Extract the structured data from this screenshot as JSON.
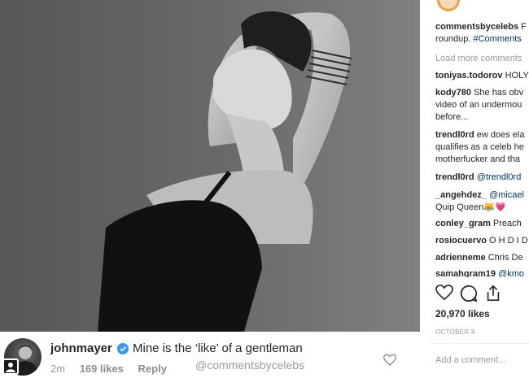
{
  "comments": [
    {
      "user": "commentsbycelebs",
      "text": " F",
      "line2_plain": "roundup. ",
      "line2_tag": "#Comments"
    },
    {
      "user": "toniyas.todorov",
      "text": " HOLY"
    },
    {
      "user": "kody780",
      "text": " She has obv",
      "line2": "video of an undermou",
      "line3": "before..."
    },
    {
      "user": "trendl0rd",
      "text": " ew does ela",
      "line2": "qualifies as a celeb he",
      "line3": "motherfucker and tha"
    },
    {
      "user": "trendl0rd",
      "mention": " @trendl0rd"
    },
    {
      "user": "_angehdez_",
      "mention": " @micael",
      "line2": "Quip Queen😹💗"
    },
    {
      "user": "conley_gram",
      "text": " Preach"
    },
    {
      "user": "rosiocuervo",
      "text": " O H D I D"
    },
    {
      "user": "adrienneme",
      "text": " Chris De"
    },
    {
      "user": "samahgram19",
      "mention": " @kmo"
    }
  ],
  "load_more": "Load more comments",
  "likes": "20,970 likes",
  "date": "OCTOBER 8",
  "add_comment_placeholder": "Add a comment...",
  "overlay": {
    "user": "johnmayer",
    "text": "Mine is the ‘like’ of a gentleman",
    "time": "2m",
    "likes": "169 likes",
    "reply": "Reply",
    "watermark": "@commentsbycelebs"
  },
  "icons": {
    "like": "heart-icon",
    "comment": "comment-bubble-icon",
    "share": "share-icon",
    "verified": "verified-badge-icon"
  },
  "colors": {
    "verified": "#3897f0",
    "mention": "#003569",
    "muted": "#999999"
  }
}
